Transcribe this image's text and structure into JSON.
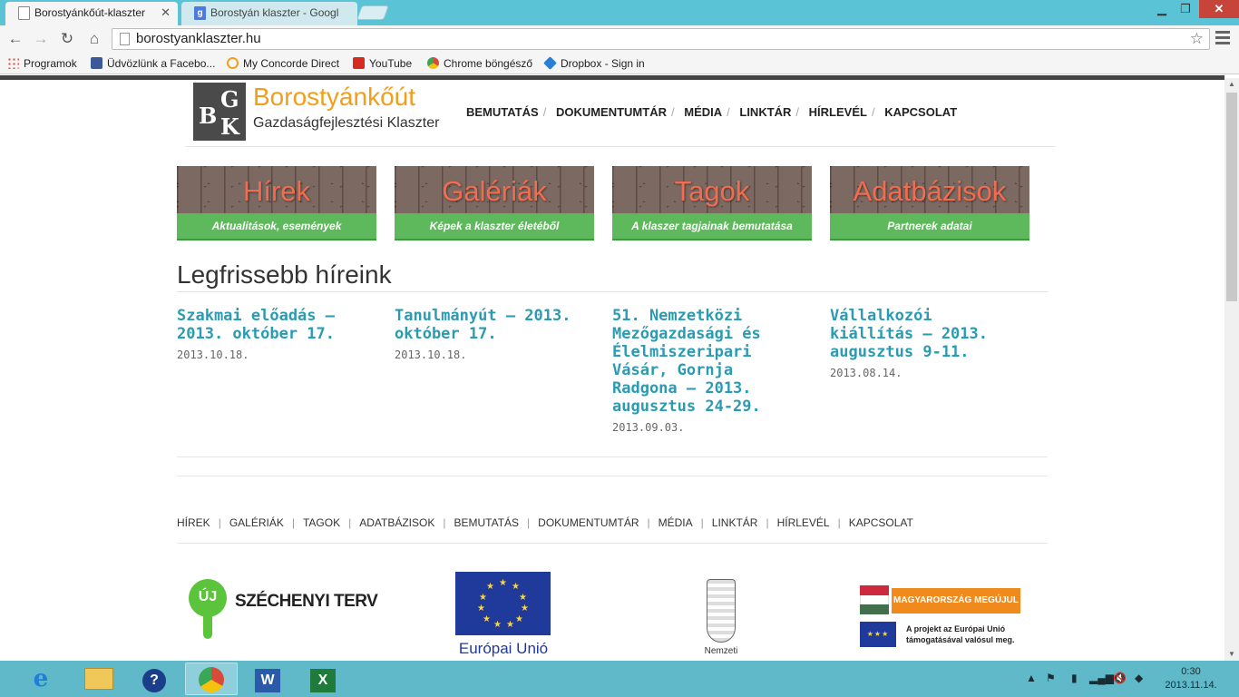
{
  "browser": {
    "tabs": [
      {
        "title": "Borostyánkőút-klaszter",
        "active": true
      },
      {
        "title": "Borostyán klaszter - Googl",
        "active": false
      }
    ],
    "url": "borostyanklaszter.hu",
    "bookmarks": [
      {
        "label": "Programok",
        "icon": "apps-grid-icon",
        "color": "#e04b3c"
      },
      {
        "label": "Üdvözlünk a Facebo...",
        "icon": "facebook-icon",
        "color": "#3b5998"
      },
      {
        "label": "My Concorde Direct",
        "icon": "concorde-icon",
        "color": "#f0a020"
      },
      {
        "label": "YouTube",
        "icon": "youtube-icon",
        "color": "#d62b20"
      },
      {
        "label": "Chrome böngésző",
        "icon": "chrome-icon",
        "color": "#4a9d3a"
      },
      {
        "label": "Dropbox - Sign in",
        "icon": "dropbox-icon",
        "color": "#2a7fd4"
      }
    ]
  },
  "site": {
    "logo": {
      "mark_letters": [
        "G",
        "B",
        "K"
      ],
      "name": "Borostyánkőút",
      "subtitle": "Gazdaságfejlesztési Klaszter"
    },
    "nav": [
      "BEMUTATÁS",
      "DOKUMENTUMTÁR",
      "MÉDIA",
      "LINKTÁR",
      "HÍRLEVÉL",
      "KAPCSOLAT"
    ],
    "tiles": [
      {
        "title": "Hírek",
        "caption": "Aktualitások, események"
      },
      {
        "title": "Galériák",
        "caption": "Képek a klaszter életéből"
      },
      {
        "title": "Tagok",
        "caption": "A klaszer tagjainak bemutatása"
      },
      {
        "title": "Adatbázisok",
        "caption": "Partnerek adatai"
      }
    ],
    "news_heading": "Legfrissebb híreink",
    "news": [
      {
        "title": "Szakmai előadás – 2013. október 17.",
        "date": "2013.10.18."
      },
      {
        "title": "Tanulmányút – 2013. október 17.",
        "date": "2013.10.18."
      },
      {
        "title": "51. Nemzetközi Mezőgazdasági és Élelmiszeripari Vásár, Gornja Radgona – 2013. augusztus 24-29.",
        "date": "2013.09.03."
      },
      {
        "title": "Vállalkozói kiállítás – 2013. augusztus 9-11.",
        "date": "2013.08.14."
      }
    ],
    "footer_nav": [
      "HÍREK",
      "GALÉRIÁK",
      "TAGOK",
      "ADATBÁZISOK",
      "BEMUTATÁS",
      "DOKUMENTUMTÁR",
      "MÉDIA",
      "LINKTÁR",
      "HÍRLEVÉL",
      "KAPCSOLAT"
    ],
    "partners": {
      "szechenyi": {
        "pin": "ÚJ",
        "label": "SZÉCHENYI TERV"
      },
      "eu": {
        "label": "Európai Unió"
      },
      "ndp": {
        "label": "Nemzeti"
      },
      "mm": {
        "banner": "MAGYARORSZÁG MEGÚJUL",
        "line1": "A projekt az Európai Unió",
        "line2": "támogatásával valósul meg."
      }
    }
  },
  "taskbar": {
    "time": "0:30",
    "date": "2013.11.14.",
    "apps": [
      "internet-explorer-icon",
      "file-explorer-icon",
      "help-icon",
      "chrome-icon",
      "word-icon",
      "excel-icon"
    ]
  }
}
